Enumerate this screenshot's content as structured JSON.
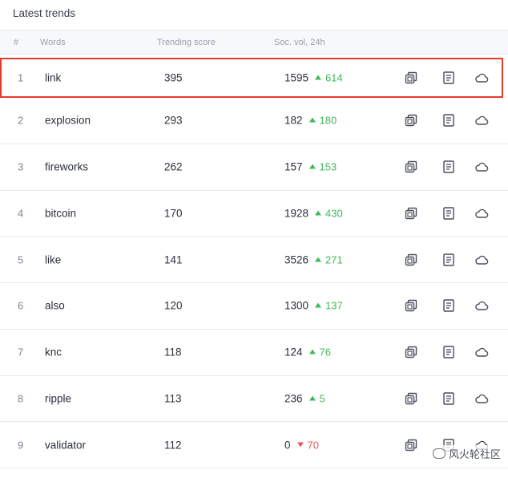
{
  "panel": {
    "title": "Latest trends"
  },
  "headers": {
    "num": "#",
    "words": "Words",
    "score": "Trending score",
    "vol": "Soc. vol, 24h"
  },
  "rows": [
    {
      "num": "1",
      "word": "link",
      "score": "395",
      "vol": "1595",
      "change": "614",
      "dir": "up",
      "highlighted": true
    },
    {
      "num": "2",
      "word": "explosion",
      "score": "293",
      "vol": "182",
      "change": "180",
      "dir": "up"
    },
    {
      "num": "3",
      "word": "fireworks",
      "score": "262",
      "vol": "157",
      "change": "153",
      "dir": "up"
    },
    {
      "num": "4",
      "word": "bitcoin",
      "score": "170",
      "vol": "1928",
      "change": "430",
      "dir": "up"
    },
    {
      "num": "5",
      "word": "like",
      "score": "141",
      "vol": "3526",
      "change": "271",
      "dir": "up"
    },
    {
      "num": "6",
      "word": "also",
      "score": "120",
      "vol": "1300",
      "change": "137",
      "dir": "up"
    },
    {
      "num": "7",
      "word": "knc",
      "score": "118",
      "vol": "124",
      "change": "76",
      "dir": "up"
    },
    {
      "num": "8",
      "word": "ripple",
      "score": "113",
      "vol": "236",
      "change": "5",
      "dir": "up"
    },
    {
      "num": "9",
      "word": "validator",
      "score": "112",
      "vol": "0",
      "change": "70",
      "dir": "down"
    }
  ],
  "icons": [
    "copy-icon",
    "document-icon",
    "cloud-icon"
  ],
  "colors": {
    "up": "#40b95b",
    "down": "#e5565a",
    "highlight": "#e53a2a"
  },
  "watermark": "风火轮社区"
}
